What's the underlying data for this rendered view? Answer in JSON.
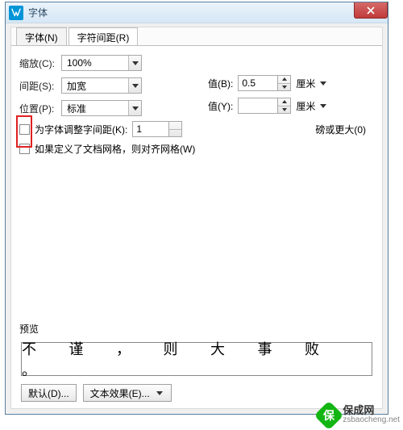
{
  "window": {
    "title": "字体"
  },
  "tabs": {
    "font": "字体(N)",
    "spacing": "字符间距(R)"
  },
  "form": {
    "zoom_label": "缩放(C):",
    "zoom_value": "100%",
    "spacing_label": "间距(S):",
    "spacing_value": "加宽",
    "position_label": "位置(P):",
    "position_value": "标准",
    "value_b_label": "值(B):",
    "value_b": "0.5",
    "value_y_label": "值(Y):",
    "value_y": "",
    "unit": "厘米"
  },
  "checks": {
    "kerning": "为字体调整字间距(K):",
    "kerning_val": "1",
    "kerning_pts": "磅或更大(0)",
    "snap": "如果定义了文档网格，则对齐网格(W)"
  },
  "preview": {
    "label": "预览",
    "text": "不 谨 ， 则 大 事 败 。"
  },
  "buttons": {
    "default": "默认(D)...",
    "effects": "文本效果(E)..."
  },
  "watermark": {
    "brand": "保成网",
    "url": "zsbaocheng.net"
  }
}
